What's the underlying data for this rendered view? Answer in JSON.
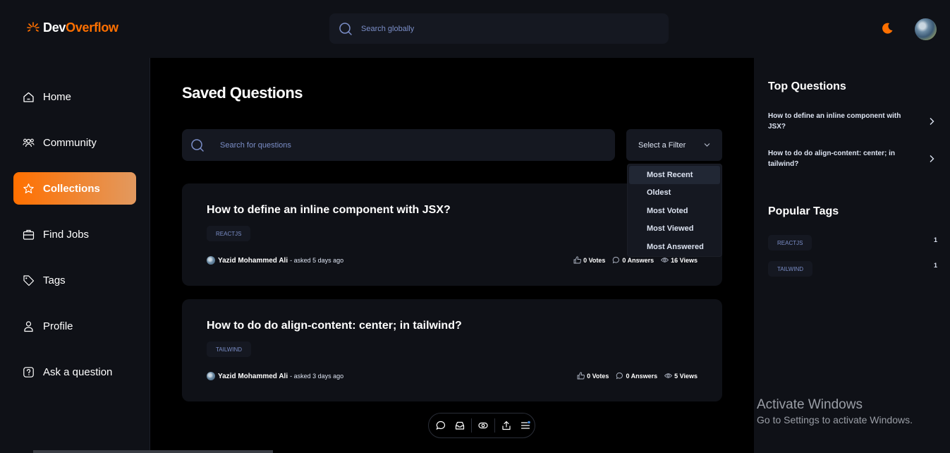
{
  "app": {
    "logo_prefix": "Dev",
    "logo_suffix": "Overflow",
    "brand_color": "#ff7000",
    "global_search_placeholder": "Search globally"
  },
  "sidebar": {
    "items": [
      {
        "label": "Home",
        "icon": "home-icon"
      },
      {
        "label": "Community",
        "icon": "users-icon"
      },
      {
        "label": "Collections",
        "icon": "star-icon",
        "active": true
      },
      {
        "label": "Find Jobs",
        "icon": "suitcase-icon"
      },
      {
        "label": "Tags",
        "icon": "tag-icon"
      },
      {
        "label": "Profile",
        "icon": "user-icon"
      },
      {
        "label": "Ask a question",
        "icon": "question-icon"
      }
    ]
  },
  "main": {
    "title": "Saved Questions",
    "search_placeholder": "Search for questions",
    "filter": {
      "label": "Select a Filter",
      "options": [
        "Most Recent",
        "Oldest",
        "Most Voted",
        "Most Viewed",
        "Most Answered"
      ],
      "highlighted": "Most Recent"
    },
    "questions": [
      {
        "title": "How to define an inline component with JSX?",
        "tag": "REACTJS",
        "author": "Yazid Mohammed Ali",
        "asked": "- asked 5 days ago",
        "votes": "0 Votes",
        "answers": "0 Answers",
        "views": "16 Views"
      },
      {
        "title": "How to do do align-content: center; in tailwind?",
        "tag": "TAILWIND",
        "author": "Yazid Mohammed Ali",
        "asked": "- asked 3 days ago",
        "votes": "0 Votes",
        "answers": "0 Answers",
        "views": "5 Views"
      }
    ]
  },
  "rightbar": {
    "top_questions_heading": "Top Questions",
    "top_questions": [
      "How to define an inline component with JSX?",
      "How to do do align-content: center; in tailwind?"
    ],
    "popular_tags_heading": "Popular Tags",
    "popular_tags": [
      {
        "name": "REACTJS",
        "count": "1"
      },
      {
        "name": "TAILWIND",
        "count": "1"
      }
    ]
  },
  "watermark": {
    "line1": "Activate Windows",
    "line2": "Go to Settings to activate Windows."
  }
}
